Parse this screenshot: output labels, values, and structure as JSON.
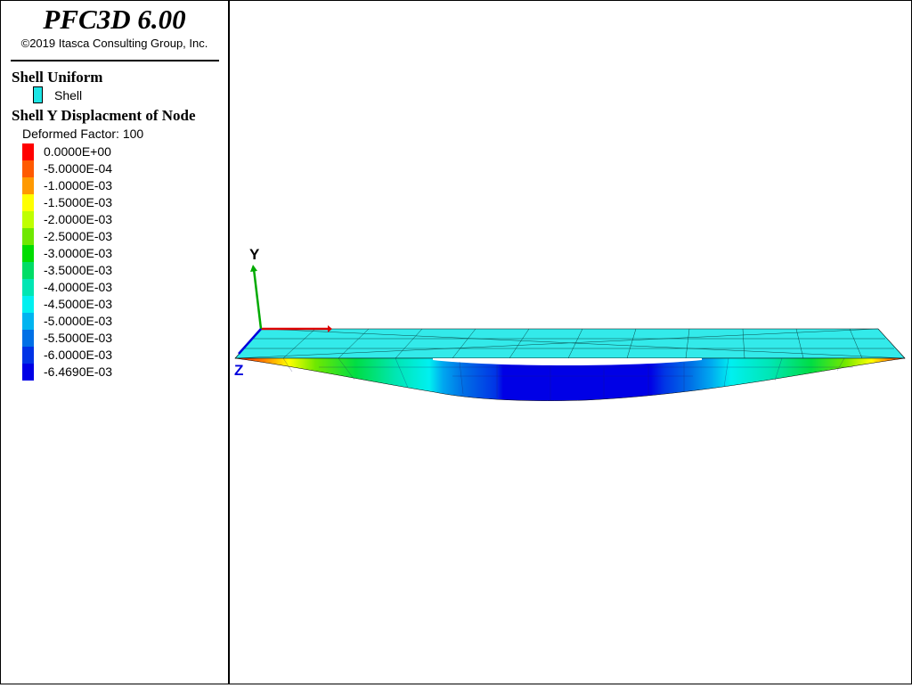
{
  "app": {
    "title": "PFC3D 6.00",
    "copyright": "©2019 Itasca Consulting Group, Inc."
  },
  "legend": {
    "uniform": {
      "heading": "Shell Uniform",
      "item_label": "Shell",
      "item_color": "#1de5e5"
    },
    "contour": {
      "heading": "Shell Y Displacment of Node",
      "deformed_label": "Deformed Factor: 100",
      "entries": [
        {
          "label": "0.0000E+00",
          "color": "#ff0000"
        },
        {
          "label": "-5.0000E-04",
          "color": "#ff5a00"
        },
        {
          "label": "-1.0000E-03",
          "color": "#ff9900"
        },
        {
          "label": "-1.5000E-03",
          "color": "#ffff00"
        },
        {
          "label": "-2.0000E-03",
          "color": "#bfff00"
        },
        {
          "label": "-2.5000E-03",
          "color": "#6fe800"
        },
        {
          "label": "-3.0000E-03",
          "color": "#00dd00"
        },
        {
          "label": "-3.5000E-03",
          "color": "#00dd66"
        },
        {
          "label": "-4.0000E-03",
          "color": "#00e6b3"
        },
        {
          "label": "-4.5000E-03",
          "color": "#00f0f0"
        },
        {
          "label": "-5.0000E-03",
          "color": "#00b4f0"
        },
        {
          "label": "-5.5000E-03",
          "color": "#0070e6"
        },
        {
          "label": "-6.0000E-03",
          "color": "#0033e6"
        },
        {
          "label": "-6.4690E-03",
          "color": "#0000e6"
        }
      ]
    }
  },
  "viewport": {
    "axes": {
      "y_label": "Y",
      "z_label": "Z",
      "x_color": "#dd0000",
      "y_color": "#00aa00",
      "z_color": "#0000dd"
    }
  }
}
